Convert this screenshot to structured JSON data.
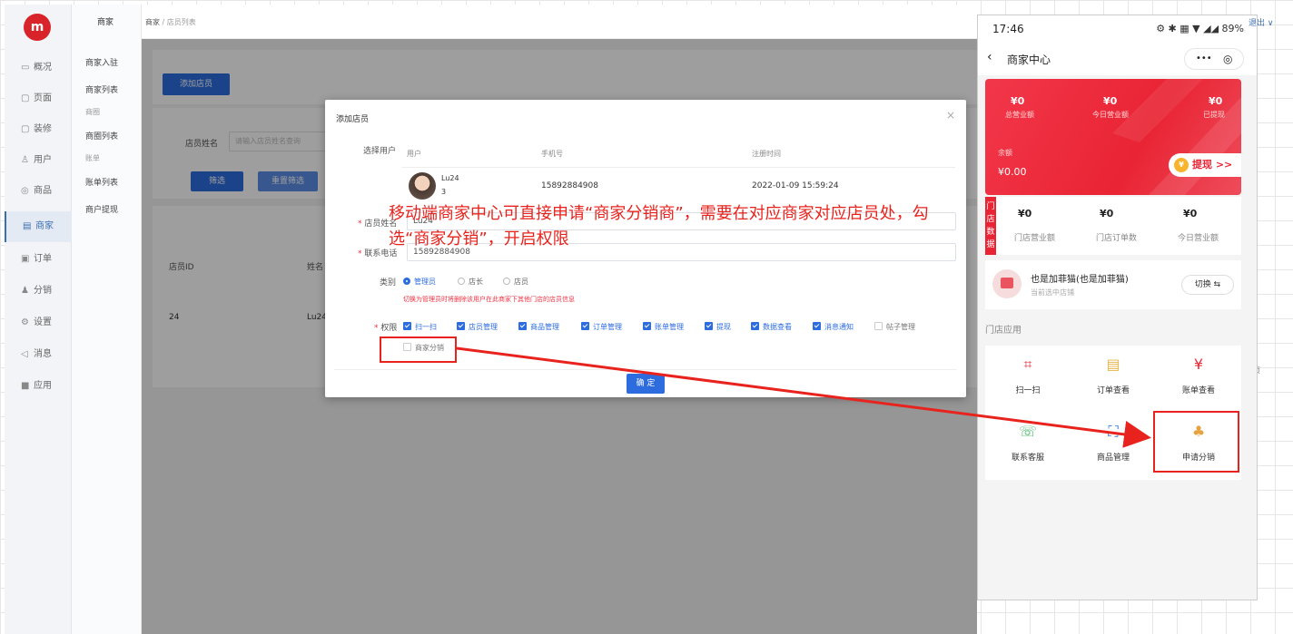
{
  "nav": {
    "logo": "m",
    "items": [
      {
        "icon": "▭",
        "label": "概况"
      },
      {
        "icon": "▢",
        "label": "页面"
      },
      {
        "icon": "▢",
        "label": "装修"
      },
      {
        "icon": "♙",
        "label": "用户"
      },
      {
        "icon": "◎",
        "label": "商品"
      },
      {
        "icon": "▤",
        "label": "商家"
      },
      {
        "icon": "▣",
        "label": "订单"
      },
      {
        "icon": "♟",
        "label": "分销"
      },
      {
        "icon": "⚙",
        "label": "设置"
      },
      {
        "icon": "◁",
        "label": "消息"
      },
      {
        "icon": "■",
        "label": "应用"
      }
    ]
  },
  "subnav": {
    "head": "商家",
    "items": [
      "商家入驻",
      "商家列表",
      "商圈",
      "商圈列表",
      "账单",
      "账单列表",
      "商户提现"
    ]
  },
  "breadcrumb": {
    "root": "商家",
    "sep": "/",
    "current": "店员列表"
  },
  "page": {
    "add_button": "添加店员",
    "filter_label": "店员姓名",
    "filter_placeholder": "请输入店员姓名查询",
    "filter_button": "筛选",
    "reset_button": "重置筛选",
    "col_id": "店员ID",
    "col_name": "姓名",
    "row_id": "24",
    "row_name": "Lu24",
    "right_edge": "页"
  },
  "modal": {
    "title": "添加店员",
    "close": "×",
    "select_user_label": "选择用户",
    "col_user": "用户",
    "col_phone": "手机号",
    "col_reg": "注册时间",
    "user_name": "Lu24",
    "user_sub": "3",
    "user_phone": "15892884908",
    "user_reg": "2022-01-09 15:59:24",
    "name_label": "店员姓名",
    "name_value": "Lu24",
    "phone_label": "联系电话",
    "phone_value": "15892884908",
    "type_label": "类别",
    "types": [
      "管理员",
      "店长",
      "店员"
    ],
    "type_hint": "切换为管理员时将删除该用户在此商家下其他门店的店员信息",
    "perm_label": "权限",
    "perms_on": [
      "扫一扫",
      "店员管理",
      "商品管理",
      "订单管理",
      "账单管理",
      "提现",
      "数据查看",
      "消息通知"
    ],
    "perm_off_1": "帖子管理",
    "perm_off_2": "商家分销",
    "confirm": "确 定"
  },
  "annotation": "移动端商家中心可直接申请“商家分销商”，需要在对应商家对应店员处，勾选“商家分销”，开启权限",
  "phone": {
    "time": "17:46",
    "status_right": "⚙ ✱ ▦ ▼ ◢◢ 89%",
    "nav_title": "商家中心",
    "caps_dots": "•••",
    "caps_target": "◎",
    "stats": [
      {
        "value": "¥0",
        "label": "总营业额"
      },
      {
        "value": "¥0",
        "label": "今日营业额"
      },
      {
        "value": "¥0",
        "label": "已提现"
      }
    ],
    "balance_label": "余额",
    "balance_value": "¥0.00",
    "withdraw": "提现 >>",
    "store_tag": "门店数据",
    "store_stats": [
      {
        "value": "¥0",
        "label": "门店营业额"
      },
      {
        "value": "¥0",
        "label": "门店订单数"
      },
      {
        "value": "¥0",
        "label": "今日营业额"
      }
    ],
    "shop_name": "也是加菲猫(也是加菲猫)",
    "shop_sub": "当前选中店铺",
    "switch": "切换 ⇆",
    "apps_title": "门店应用",
    "apps": [
      {
        "icon": "⌗",
        "label": "扫一扫"
      },
      {
        "icon": "▤",
        "label": "订单查看"
      },
      {
        "icon": "¥",
        "label": "账单查看"
      },
      {
        "icon": "☏",
        "label": "联系客服"
      },
      {
        "icon": "⛶",
        "label": "商品管理"
      },
      {
        "icon": "♣",
        "label": "申请分销"
      }
    ]
  },
  "top_right": "退出 ∨",
  "colors": {
    "accent": "#2d6cdf",
    "annotation": "#e8231d",
    "brand_red": "#e92434"
  }
}
